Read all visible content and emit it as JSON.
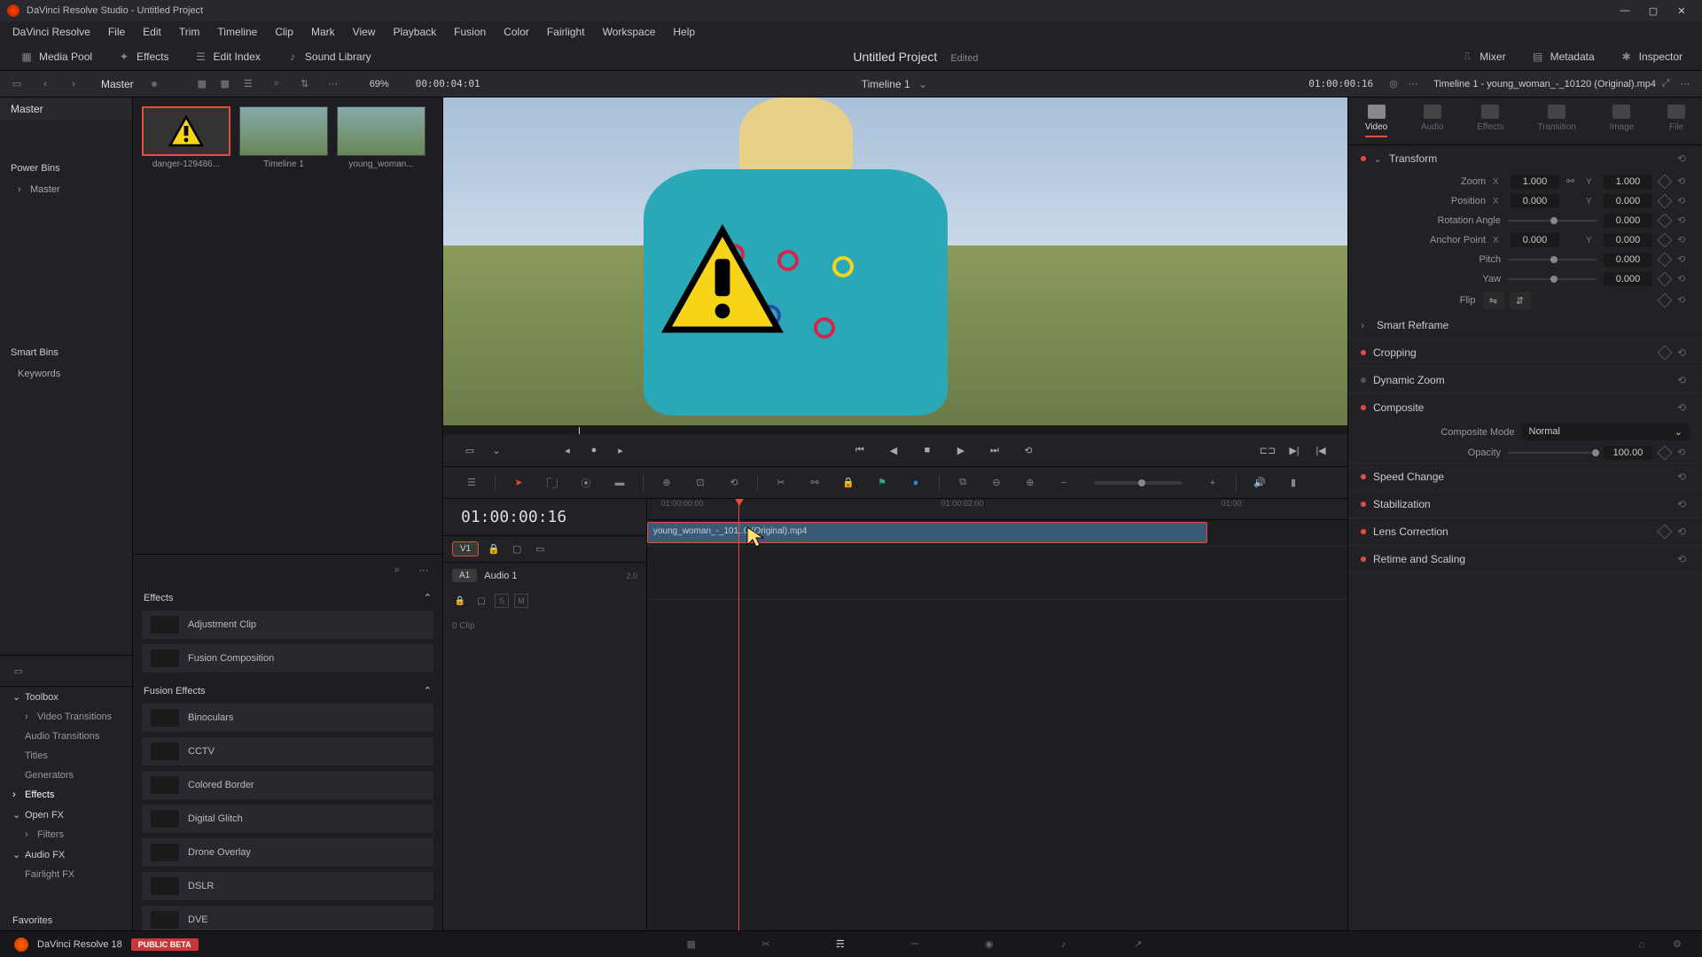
{
  "titlebar": {
    "title": "DaVinci Resolve Studio - Untitled Project"
  },
  "menu": [
    "DaVinci Resolve",
    "File",
    "Edit",
    "Trim",
    "Timeline",
    "Clip",
    "Mark",
    "View",
    "Playback",
    "Fusion",
    "Color",
    "Fairlight",
    "Workspace",
    "Help"
  ],
  "toolbar": {
    "media_pool": "Media Pool",
    "effects": "Effects",
    "edit_index": "Edit Index",
    "sound_library": "Sound Library",
    "project_title": "Untitled Project",
    "project_status": "Edited",
    "mixer": "Mixer",
    "metadata": "Metadata",
    "inspector": "Inspector"
  },
  "subtoolbar": {
    "breadcrumb": "Master",
    "zoom": "69%",
    "tc_left": "00:00:04:01",
    "timeline_dropdown": "Timeline 1",
    "tc_right": "01:00:00:16",
    "timeline_label": "Timeline 1 - young_woman_-_10120 (Original).mp4"
  },
  "bins": {
    "master_tab": "Master",
    "power_bins": "Power Bins",
    "power_master": "Master",
    "smart_bins": "Smart Bins",
    "keywords": "Keywords"
  },
  "left_tree": {
    "toolbox": "Toolbox",
    "video_trans": "Video Transitions",
    "audio_trans": "Audio Transitions",
    "titles": "Titles",
    "generators": "Generators",
    "effects": "Effects",
    "openfx": "Open FX",
    "filters": "Filters",
    "audiofx": "Audio FX",
    "fairlight": "Fairlight FX",
    "favorites": "Favorites"
  },
  "thumbs": [
    {
      "label": "danger-129486..."
    },
    {
      "label": "Timeline 1"
    },
    {
      "label": "young_woman..."
    }
  ],
  "effects_panel": {
    "group1": "Effects",
    "items1": [
      "Adjustment Clip",
      "Fusion Composition"
    ],
    "group2": "Fusion Effects",
    "items2": [
      "Binoculars",
      "CCTV",
      "Colored Border",
      "Digital Glitch",
      "Drone Overlay",
      "DSLR",
      "DVE"
    ]
  },
  "timeline": {
    "tc": "01:00:00:16",
    "v1": "V1",
    "a1": "A1",
    "audio1": "Audio 1",
    "audio_meta": "2.0",
    "clip_zero": "0 Clip",
    "s": "S",
    "m": "M",
    "clip_name": "young_woman_-_101..0 (Original).mp4",
    "ruler": [
      "01:00:00:00",
      "01:00:02:00",
      "01:00:"
    ]
  },
  "inspector": {
    "tabs": [
      "Video",
      "Audio",
      "Effects",
      "Transition",
      "Image",
      "File"
    ],
    "transform": {
      "title": "Transform",
      "zoom": "Zoom",
      "zoom_x": "1.000",
      "zoom_y": "1.000",
      "position": "Position",
      "pos_x": "0.000",
      "pos_y": "0.000",
      "rotation": "Rotation Angle",
      "rot_val": "0.000",
      "anchor": "Anchor Point",
      "anc_x": "0.000",
      "anc_y": "0.000",
      "pitch": "Pitch",
      "pitch_val": "0.000",
      "yaw": "Yaw",
      "yaw_val": "0.000",
      "flip": "Flip"
    },
    "smart_reframe": "Smart Reframe",
    "cropping": "Cropping",
    "dynamic_zoom": "Dynamic Zoom",
    "composite": {
      "title": "Composite",
      "mode_label": "Composite Mode",
      "mode": "Normal",
      "opacity_label": "Opacity",
      "opacity": "100.00"
    },
    "speed": "Speed Change",
    "stabilization": "Stabilization",
    "lens": "Lens Correction",
    "retime": "Retime and Scaling"
  },
  "bottombar": {
    "app": "DaVinci Resolve 18",
    "badge": "PUBLIC BETA"
  }
}
